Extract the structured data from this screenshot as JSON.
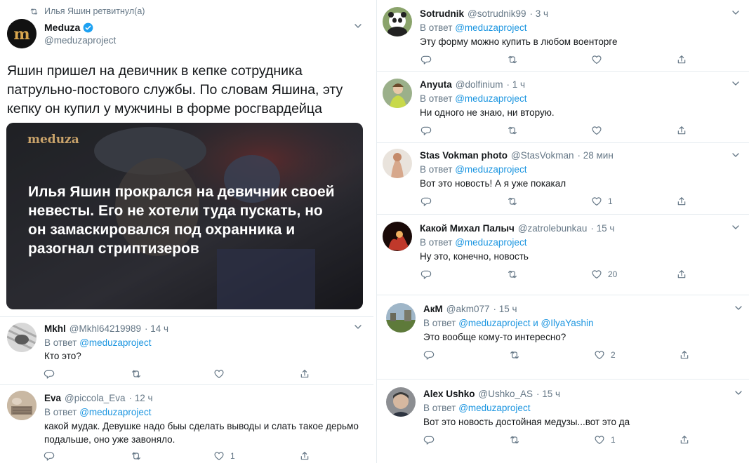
{
  "left": {
    "retweet_banner": "Илья Яшин ретвитнул(а)",
    "main_tweet": {
      "author": "Meduza",
      "handle": "@meduzaproject",
      "text": "Яшин пришел на девичник в кепке сотрудника патрульно-постового службы. По словам Яшина, эту кепку он купил у мужчины в форме росгвардейца",
      "card_logo": "meduza",
      "card_headline": "Илья Яшин прокрался на девичник своей невесты. Его не хотели туда пускать, но он замаскировался под охранника и разогнал стриптизеров"
    },
    "replies": [
      {
        "name": "Mkhl",
        "handle": "@Mkhl64219989",
        "time": "· 14 ч",
        "reply_prefix": "В ответ",
        "reply_to": "@meduzaproject",
        "text": "Кто это?",
        "likes": ""
      },
      {
        "name": "Eva",
        "handle": "@piccola_Eva",
        "time": "· 12 ч",
        "reply_prefix": "В ответ",
        "reply_to": "@meduzaproject",
        "text": "какой мудак. Девушке надо быы сделать выводы и слать такое дерьмо подальше, оно уже завоняло.",
        "likes": "1"
      }
    ]
  },
  "right": {
    "replies": [
      {
        "name": "Sotrudnik",
        "handle": "@sotrudnik99",
        "time": "· 3 ч",
        "reply_prefix": "В ответ",
        "reply_to": "@meduzaproject",
        "reply_extra": "",
        "text": "Эту форму можно купить в любом военторге",
        "likes": ""
      },
      {
        "name": "Anyuta",
        "handle": "@dolfinium",
        "time": "· 1 ч",
        "reply_prefix": "В ответ",
        "reply_to": "@meduzaproject",
        "reply_extra": "",
        "text": "Ни одного не знаю, ни вторую.",
        "likes": ""
      },
      {
        "name": "Stas Vokman photo",
        "handle": "@StasVokman",
        "time": "· 28 мин",
        "reply_prefix": "В ответ",
        "reply_to": "@meduzaproject",
        "reply_extra": "",
        "text": "Вот это новость! А я уже покакал",
        "likes": "1"
      },
      {
        "name": "Какой Михал Палыч",
        "handle": "@zatrolebunkau",
        "time": "· 15 ч",
        "reply_prefix": "В ответ",
        "reply_to": "@meduzaproject",
        "reply_extra": "",
        "text": "Ну это, конечно, новость",
        "likes": "20"
      },
      {
        "name": "АкМ",
        "handle": "@akm077",
        "time": "· 15 ч",
        "reply_prefix": "В ответ",
        "reply_to": "@meduzaproject",
        "reply_extra": "и @IlyaYashin",
        "text": "Это вообще кому-то интересно?",
        "likes": "2"
      },
      {
        "name": "Alex Ushko",
        "handle": "@Ushko_AS",
        "time": "· 15 ч",
        "reply_prefix": "В ответ",
        "reply_to": "@meduzaproject",
        "reply_extra": "",
        "text": "Вот это новость достойная медузы...вот это да",
        "likes": "1"
      }
    ]
  },
  "colors": {
    "link": "#1b95e0",
    "muted": "#657786",
    "text": "#14171a",
    "verified": "#1da1f2"
  },
  "icons": [
    "retweet-icon",
    "verified-icon",
    "chevron-down-icon",
    "reply-icon",
    "like-icon",
    "share-icon"
  ]
}
